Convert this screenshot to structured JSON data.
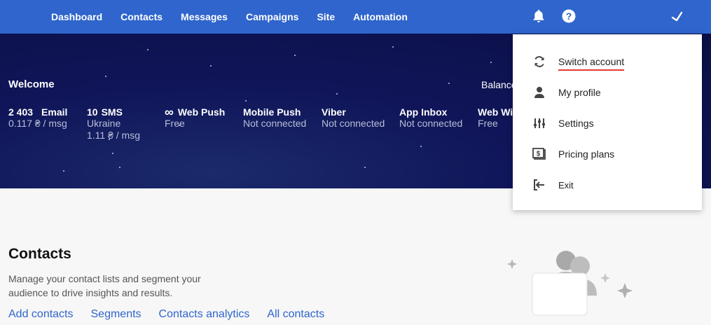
{
  "nav": {
    "items": [
      "Dashboard",
      "Contacts",
      "Messages",
      "Campaigns",
      "Site",
      "Automation"
    ],
    "icons": [
      "bell-icon",
      "help-icon",
      "user-menu-icon"
    ]
  },
  "hero": {
    "welcome": "Welcome",
    "balance": "Balance",
    "stats": [
      {
        "count": "2 403",
        "name": "Email",
        "sub1": "0.117 ₴ / msg",
        "sub2": ""
      },
      {
        "count": "10",
        "name": "SMS",
        "sub1": "Ukraine",
        "sub2": "1.11 ₴ / msg"
      },
      {
        "icon": "infinity-icon",
        "name": "Web Push",
        "sub1": "Free",
        "sub2": ""
      },
      {
        "name": "Mobile Push",
        "sub1": "Not connected"
      },
      {
        "name": "Viber",
        "sub1": "Not connected"
      },
      {
        "name": "App Inbox",
        "sub1": "Not connected"
      },
      {
        "name": "Web Wid",
        "sub1": "Free"
      }
    ]
  },
  "dropdown": {
    "items": [
      {
        "label": "Switch account",
        "icon": "switch-icon"
      },
      {
        "label": "My profile",
        "icon": "person-icon"
      },
      {
        "label": "Settings",
        "icon": "settings-sliders-icon"
      },
      {
        "label": "Pricing plans",
        "icon": "pricing-icon"
      },
      {
        "label": "Exit",
        "icon": "exit-icon"
      }
    ]
  },
  "contacts": {
    "title": "Contacts",
    "description": "Manage your contact lists and segment your audience to drive insights and results.",
    "links": [
      "Add contacts",
      "Segments",
      "Contacts analytics",
      "All contacts"
    ]
  },
  "colors": {
    "nav_bg": "#2f65cc",
    "hero_bg": "#0f1558",
    "link": "#2f65cc",
    "underline": "#e53935"
  }
}
